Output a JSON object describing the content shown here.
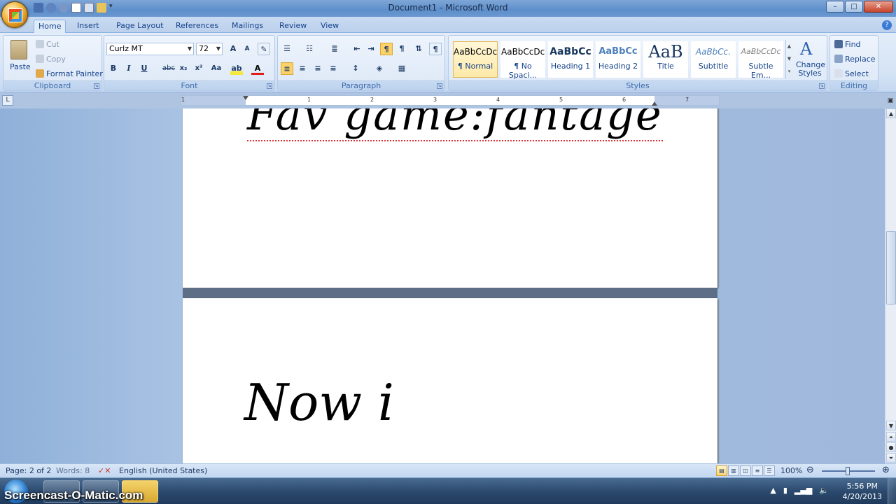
{
  "window": {
    "title": "Document1 - Microsoft Word",
    "controls": {
      "minimize": "–",
      "maximize": "□",
      "close": "✕"
    }
  },
  "tabs": [
    "Home",
    "Insert",
    "Page Layout",
    "References",
    "Mailings",
    "Review",
    "View"
  ],
  "clipboard": {
    "paste": "Paste",
    "cut": "Cut",
    "copy": "Copy",
    "format_painter": "Format Painter",
    "label": "Clipboard"
  },
  "font": {
    "name": "Curlz MT",
    "size": "72",
    "bold": "B",
    "italic": "I",
    "underline": "U",
    "strike": "abc",
    "subscript": "x₂",
    "superscript": "x²",
    "change_case": "Aa",
    "label": "Font"
  },
  "paragraph": {
    "label": "Paragraph",
    "pilcrow": "¶"
  },
  "styles": {
    "label": "Styles",
    "items": [
      {
        "preview": "AaBbCcDc",
        "name": "¶ Normal"
      },
      {
        "preview": "AaBbCcDc",
        "name": "¶ No Spaci..."
      },
      {
        "preview": "AaBbCc",
        "name": "Heading 1"
      },
      {
        "preview": "AaBbCc",
        "name": "Heading 2"
      },
      {
        "preview": "AaB",
        "name": "Title"
      },
      {
        "preview": "AaBbCc.",
        "name": "Subtitle"
      },
      {
        "preview": "AaBbCcDc",
        "name": "Subtle Em..."
      }
    ],
    "change_styles": "Change Styles"
  },
  "editing": {
    "label": "Editing",
    "find": "Find",
    "replace": "Replace",
    "select": "Select"
  },
  "ruler": {
    "numbers": [
      "1",
      "1",
      "2",
      "3",
      "4",
      "5",
      "6",
      "7"
    ]
  },
  "document": {
    "page1_text": "Fav game:fantage",
    "page2_text": "Now i"
  },
  "status": {
    "page": "Page: 2 of 2",
    "words": "Words: 8",
    "language": "English (United States)",
    "zoom": "100%"
  },
  "taskbar": {
    "recorder_label": "Screencast-O-Matic.com",
    "time": "5:56 PM",
    "date": "4/20/2013"
  },
  "colors": {
    "ribbon_text": "#15428b",
    "selected_style": "#fde9a8",
    "spell_underline": "#dd3333"
  }
}
